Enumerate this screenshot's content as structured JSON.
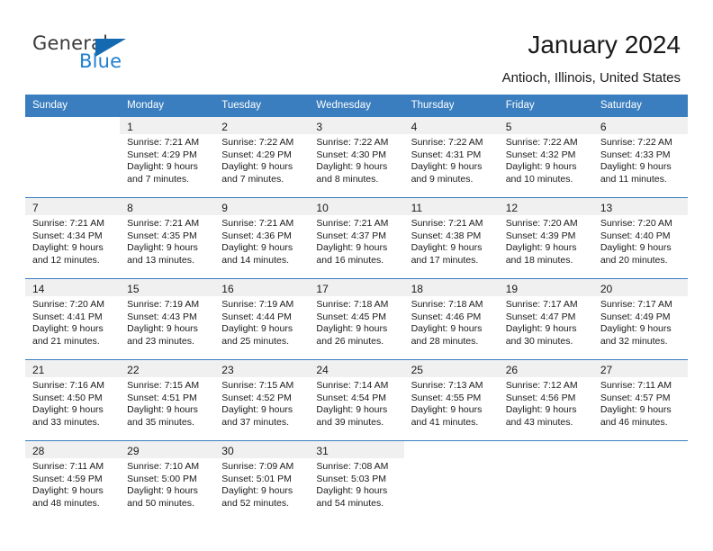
{
  "brand": {
    "name_top": "General",
    "name_bottom": "Blue",
    "accent_color": "#1f7fd0",
    "triangle_color": "#1469b0"
  },
  "header": {
    "title": "January 2024",
    "subtitle": "Antioch, Illinois, United States"
  },
  "theme": {
    "header_row_bg": "#3a7ebf",
    "header_row_text": "#ffffff",
    "row_band_bg": "#f0f0f0",
    "row_border": "#3a7ebf",
    "text": "#1a1a1a"
  },
  "weekdays": [
    "Sunday",
    "Monday",
    "Tuesday",
    "Wednesday",
    "Thursday",
    "Friday",
    "Saturday"
  ],
  "labels": {
    "sunrise_prefix": "Sunrise:",
    "sunset_prefix": "Sunset:",
    "daylight_prefix": "Daylight:"
  },
  "weeks": [
    [
      {
        "day": "",
        "sunrise": "",
        "sunset": "",
        "daylight_line1": "",
        "daylight_line2": "",
        "empty": true
      },
      {
        "day": "1",
        "sunrise": "Sunrise: 7:21 AM",
        "sunset": "Sunset: 4:29 PM",
        "daylight_line1": "Daylight: 9 hours",
        "daylight_line2": "and 7 minutes."
      },
      {
        "day": "2",
        "sunrise": "Sunrise: 7:22 AM",
        "sunset": "Sunset: 4:29 PM",
        "daylight_line1": "Daylight: 9 hours",
        "daylight_line2": "and 7 minutes."
      },
      {
        "day": "3",
        "sunrise": "Sunrise: 7:22 AM",
        "sunset": "Sunset: 4:30 PM",
        "daylight_line1": "Daylight: 9 hours",
        "daylight_line2": "and 8 minutes."
      },
      {
        "day": "4",
        "sunrise": "Sunrise: 7:22 AM",
        "sunset": "Sunset: 4:31 PM",
        "daylight_line1": "Daylight: 9 hours",
        "daylight_line2": "and 9 minutes."
      },
      {
        "day": "5",
        "sunrise": "Sunrise: 7:22 AM",
        "sunset": "Sunset: 4:32 PM",
        "daylight_line1": "Daylight: 9 hours",
        "daylight_line2": "and 10 minutes."
      },
      {
        "day": "6",
        "sunrise": "Sunrise: 7:22 AM",
        "sunset": "Sunset: 4:33 PM",
        "daylight_line1": "Daylight: 9 hours",
        "daylight_line2": "and 11 minutes."
      }
    ],
    [
      {
        "day": "7",
        "sunrise": "Sunrise: 7:21 AM",
        "sunset": "Sunset: 4:34 PM",
        "daylight_line1": "Daylight: 9 hours",
        "daylight_line2": "and 12 minutes."
      },
      {
        "day": "8",
        "sunrise": "Sunrise: 7:21 AM",
        "sunset": "Sunset: 4:35 PM",
        "daylight_line1": "Daylight: 9 hours",
        "daylight_line2": "and 13 minutes."
      },
      {
        "day": "9",
        "sunrise": "Sunrise: 7:21 AM",
        "sunset": "Sunset: 4:36 PM",
        "daylight_line1": "Daylight: 9 hours",
        "daylight_line2": "and 14 minutes."
      },
      {
        "day": "10",
        "sunrise": "Sunrise: 7:21 AM",
        "sunset": "Sunset: 4:37 PM",
        "daylight_line1": "Daylight: 9 hours",
        "daylight_line2": "and 16 minutes."
      },
      {
        "day": "11",
        "sunrise": "Sunrise: 7:21 AM",
        "sunset": "Sunset: 4:38 PM",
        "daylight_line1": "Daylight: 9 hours",
        "daylight_line2": "and 17 minutes."
      },
      {
        "day": "12",
        "sunrise": "Sunrise: 7:20 AM",
        "sunset": "Sunset: 4:39 PM",
        "daylight_line1": "Daylight: 9 hours",
        "daylight_line2": "and 18 minutes."
      },
      {
        "day": "13",
        "sunrise": "Sunrise: 7:20 AM",
        "sunset": "Sunset: 4:40 PM",
        "daylight_line1": "Daylight: 9 hours",
        "daylight_line2": "and 20 minutes."
      }
    ],
    [
      {
        "day": "14",
        "sunrise": "Sunrise: 7:20 AM",
        "sunset": "Sunset: 4:41 PM",
        "daylight_line1": "Daylight: 9 hours",
        "daylight_line2": "and 21 minutes."
      },
      {
        "day": "15",
        "sunrise": "Sunrise: 7:19 AM",
        "sunset": "Sunset: 4:43 PM",
        "daylight_line1": "Daylight: 9 hours",
        "daylight_line2": "and 23 minutes."
      },
      {
        "day": "16",
        "sunrise": "Sunrise: 7:19 AM",
        "sunset": "Sunset: 4:44 PM",
        "daylight_line1": "Daylight: 9 hours",
        "daylight_line2": "and 25 minutes."
      },
      {
        "day": "17",
        "sunrise": "Sunrise: 7:18 AM",
        "sunset": "Sunset: 4:45 PM",
        "daylight_line1": "Daylight: 9 hours",
        "daylight_line2": "and 26 minutes."
      },
      {
        "day": "18",
        "sunrise": "Sunrise: 7:18 AM",
        "sunset": "Sunset: 4:46 PM",
        "daylight_line1": "Daylight: 9 hours",
        "daylight_line2": "and 28 minutes."
      },
      {
        "day": "19",
        "sunrise": "Sunrise: 7:17 AM",
        "sunset": "Sunset: 4:47 PM",
        "daylight_line1": "Daylight: 9 hours",
        "daylight_line2": "and 30 minutes."
      },
      {
        "day": "20",
        "sunrise": "Sunrise: 7:17 AM",
        "sunset": "Sunset: 4:49 PM",
        "daylight_line1": "Daylight: 9 hours",
        "daylight_line2": "and 32 minutes."
      }
    ],
    [
      {
        "day": "21",
        "sunrise": "Sunrise: 7:16 AM",
        "sunset": "Sunset: 4:50 PM",
        "daylight_line1": "Daylight: 9 hours",
        "daylight_line2": "and 33 minutes."
      },
      {
        "day": "22",
        "sunrise": "Sunrise: 7:15 AM",
        "sunset": "Sunset: 4:51 PM",
        "daylight_line1": "Daylight: 9 hours",
        "daylight_line2": "and 35 minutes."
      },
      {
        "day": "23",
        "sunrise": "Sunrise: 7:15 AM",
        "sunset": "Sunset: 4:52 PM",
        "daylight_line1": "Daylight: 9 hours",
        "daylight_line2": "and 37 minutes."
      },
      {
        "day": "24",
        "sunrise": "Sunrise: 7:14 AM",
        "sunset": "Sunset: 4:54 PM",
        "daylight_line1": "Daylight: 9 hours",
        "daylight_line2": "and 39 minutes."
      },
      {
        "day": "25",
        "sunrise": "Sunrise: 7:13 AM",
        "sunset": "Sunset: 4:55 PM",
        "daylight_line1": "Daylight: 9 hours",
        "daylight_line2": "and 41 minutes."
      },
      {
        "day": "26",
        "sunrise": "Sunrise: 7:12 AM",
        "sunset": "Sunset: 4:56 PM",
        "daylight_line1": "Daylight: 9 hours",
        "daylight_line2": "and 43 minutes."
      },
      {
        "day": "27",
        "sunrise": "Sunrise: 7:11 AM",
        "sunset": "Sunset: 4:57 PM",
        "daylight_line1": "Daylight: 9 hours",
        "daylight_line2": "and 46 minutes."
      }
    ],
    [
      {
        "day": "28",
        "sunrise": "Sunrise: 7:11 AM",
        "sunset": "Sunset: 4:59 PM",
        "daylight_line1": "Daylight: 9 hours",
        "daylight_line2": "and 48 minutes."
      },
      {
        "day": "29",
        "sunrise": "Sunrise: 7:10 AM",
        "sunset": "Sunset: 5:00 PM",
        "daylight_line1": "Daylight: 9 hours",
        "daylight_line2": "and 50 minutes."
      },
      {
        "day": "30",
        "sunrise": "Sunrise: 7:09 AM",
        "sunset": "Sunset: 5:01 PM",
        "daylight_line1": "Daylight: 9 hours",
        "daylight_line2": "and 52 minutes."
      },
      {
        "day": "31",
        "sunrise": "Sunrise: 7:08 AM",
        "sunset": "Sunset: 5:03 PM",
        "daylight_line1": "Daylight: 9 hours",
        "daylight_line2": "and 54 minutes."
      },
      {
        "day": "",
        "sunrise": "",
        "sunset": "",
        "daylight_line1": "",
        "daylight_line2": "",
        "empty": true
      },
      {
        "day": "",
        "sunrise": "",
        "sunset": "",
        "daylight_line1": "",
        "daylight_line2": "",
        "empty": true
      },
      {
        "day": "",
        "sunrise": "",
        "sunset": "",
        "daylight_line1": "",
        "daylight_line2": "",
        "empty": true
      }
    ]
  ]
}
